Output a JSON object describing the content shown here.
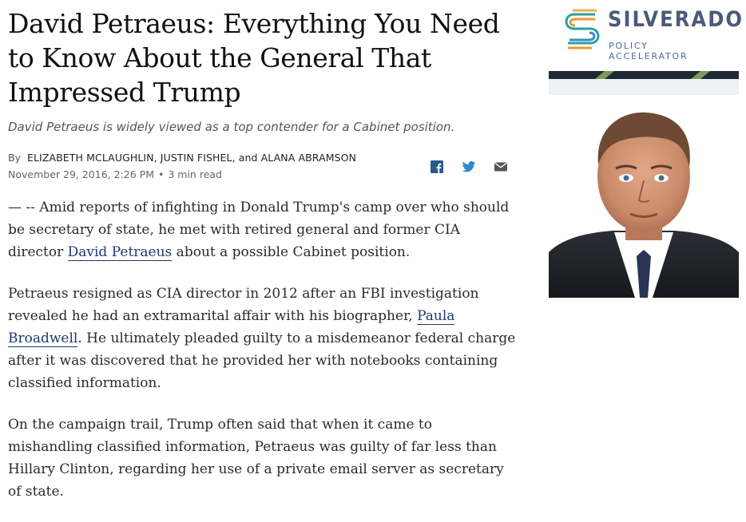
{
  "article": {
    "headline": "David Petraeus: Everything You Need to Know About the General That Impressed Trump",
    "subhead": "David Petraeus is widely viewed as a top contender for a Cabinet position.",
    "byline_prefix": "By",
    "authors": "ELIZABETH MCLAUGHLIN, JUSTIN FISHEL, and ALANA ABRAMSON",
    "date": "November 29, 2016, 2:26 PM",
    "separator": "•",
    "read_time": "3 min read",
    "paragraphs": {
      "p1_before": "— -- Amid reports of infighting in Donald Trump's camp over who should be secretary of state, he met with retired general and former CIA director ",
      "p1_link": "David Petraeus",
      "p1_after": " about a possible Cabinet position.",
      "p2_before": "Petraeus resigned as CIA director in 2012 after an FBI investigation revealed he had an extramarital affair with his biographer, ",
      "p2_link": "Paula Broadwell",
      "p2_after": ". He ultimately pleaded guilty to a misdemeanor federal charge after it was discovered that he provided her with notebooks containing classified information.",
      "p3": "On the campaign trail, Trump often said that when it came to mishandling classified information, Petraeus was guilty of far less than Hillary Clinton, regarding her use of a private email server as secretary of state."
    }
  },
  "share": {
    "icons": [
      "facebook-icon",
      "twitter-icon",
      "email-icon"
    ],
    "color": "#2a5a8a"
  },
  "ad": {
    "logo_title": "SILVERADO",
    "logo_subtitle": "POLICY ACCELERATOR",
    "colors": {
      "title": "#4a5a7a",
      "accent_orange": "#e89a3a",
      "accent_blue": "#3a8ad0",
      "accent_teal": "#2aa0a0",
      "band_dark": "#1f2a34",
      "band_green": "#7a9a5a"
    }
  }
}
